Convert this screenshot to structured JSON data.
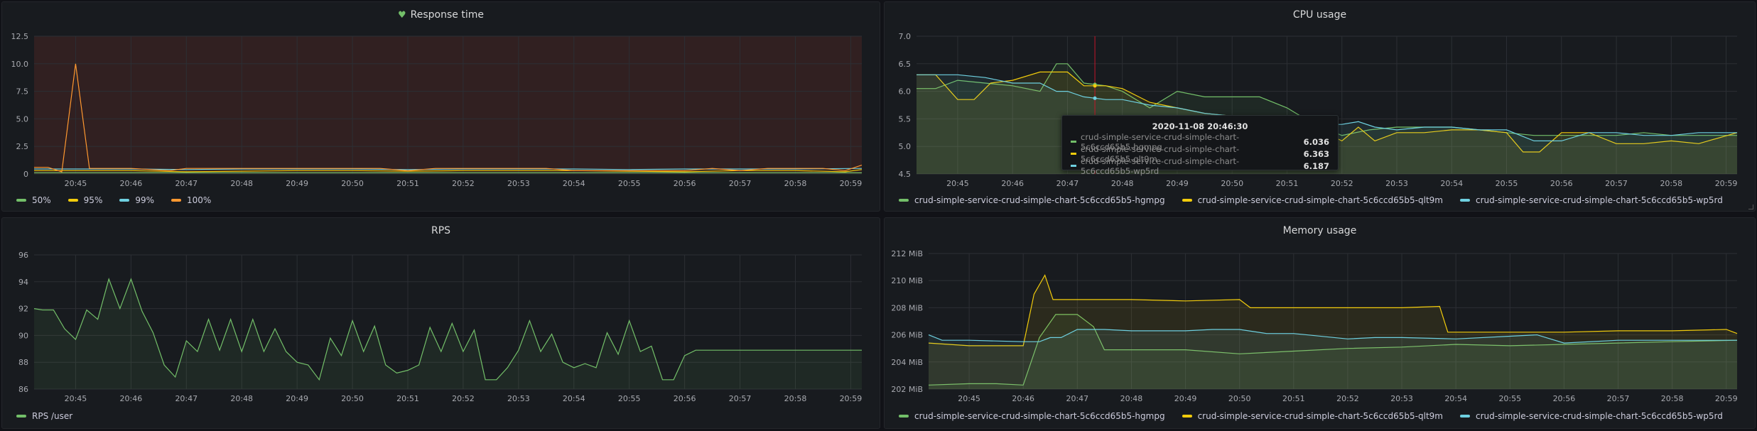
{
  "colors": {
    "green": "#73bf69",
    "yellow": "#f2cc0c",
    "blue": "#5794f2",
    "cyan": "#6ed0e0",
    "orange": "#ff9830",
    "olive": "#a8b25a"
  },
  "panels": {
    "response_time": {
      "title": "Response time",
      "legend": [
        {
          "label": "50%",
          "color": "#73bf69"
        },
        {
          "label": "95%",
          "color": "#f2cc0c"
        },
        {
          "label": "99%",
          "color": "#6ed0e0"
        },
        {
          "label": "100%",
          "color": "#ff9830"
        }
      ]
    },
    "cpu_usage": {
      "title": "CPU usage",
      "legend": [
        {
          "label": "crud-simple-service-crud-simple-chart-5c6ccd65b5-hgmpg",
          "color": "#73bf69"
        },
        {
          "label": "crud-simple-service-crud-simple-chart-5c6ccd65b5-qlt9m",
          "color": "#f2cc0c"
        },
        {
          "label": "crud-simple-service-crud-simple-chart-5c6ccd65b5-wp5rd",
          "color": "#6ed0e0"
        }
      ],
      "tooltip": {
        "time": "2020-11-08 20:46:30",
        "rows": [
          {
            "name": "crud-simple-service-crud-simple-chart-5c6ccd65b5-hgmpg",
            "value": "6.036",
            "color": "#73bf69"
          },
          {
            "name": "crud-simple-service-crud-simple-chart-5c6ccd65b5-qlt9m",
            "value": "6.363",
            "color": "#f2cc0c"
          },
          {
            "name": "crud-simple-service-crud-simple-chart-5c6ccd65b5-wp5rd",
            "value": "6.187",
            "color": "#6ed0e0"
          }
        ]
      }
    },
    "rps": {
      "title": "RPS",
      "legend": [
        {
          "label": "RPS /user",
          "color": "#73bf69"
        }
      ]
    },
    "memory_usage": {
      "title": "Memory usage",
      "legend": [
        {
          "label": "crud-simple-service-crud-simple-chart-5c6ccd65b5-hgmpg",
          "color": "#73bf69"
        },
        {
          "label": "crud-simple-service-crud-simple-chart-5c6ccd65b5-qlt9m",
          "color": "#f2cc0c"
        },
        {
          "label": "crud-simple-service-crud-simple-chart-5c6ccd65b5-wp5rd",
          "color": "#6ed0e0"
        }
      ]
    }
  },
  "chart_data": [
    {
      "id": "response_time",
      "type": "line",
      "title": "Response time",
      "x_ticks": [
        "20:45",
        "20:46",
        "20:47",
        "20:48",
        "20:49",
        "20:50",
        "20:51",
        "20:52",
        "20:53",
        "20:54",
        "20:55",
        "20:56",
        "20:57",
        "20:58",
        "20:59"
      ],
      "x_range_minutes": [
        44.25,
        59.2
      ],
      "y_ticks": [
        "0",
        "2.5",
        "5.0",
        "7.5",
        "10.0",
        "12.5"
      ],
      "ylim": [
        0,
        12.5
      ],
      "threshold_fill": "#3a2323",
      "series": [
        {
          "name": "50%",
          "color": "#73bf69",
          "x": [
            44.25,
            45.0,
            46.0,
            47.0,
            48.0,
            49.0,
            50.0,
            51.0,
            52.0,
            53.0,
            54.0,
            55.0,
            56.0,
            57.0,
            58.0,
            59.2
          ],
          "y": [
            0.1,
            0.1,
            0.1,
            0.1,
            0.1,
            0.1,
            0.1,
            0.1,
            0.1,
            0.1,
            0.1,
            0.1,
            0.1,
            0.1,
            0.1,
            0.1
          ]
        },
        {
          "name": "95%",
          "color": "#f2cc0c",
          "x": [
            44.25,
            44.5,
            45.0,
            45.5,
            46.0,
            47.0,
            48.0,
            49.0,
            50.0,
            51.0,
            52.0,
            53.0,
            54.0,
            55.0,
            56.0,
            57.0,
            58.0,
            58.9,
            59.2
          ],
          "y": [
            0.3,
            0.3,
            0.3,
            0.3,
            0.3,
            0.2,
            0.25,
            0.3,
            0.3,
            0.25,
            0.3,
            0.3,
            0.3,
            0.25,
            0.2,
            0.3,
            0.3,
            0.2,
            0.4
          ]
        },
        {
          "name": "99%",
          "color": "#6ed0e0",
          "x": [
            44.25,
            45.0,
            46.0,
            47.0,
            48.0,
            49.0,
            50.0,
            51.0,
            52.0,
            53.0,
            54.0,
            55.0,
            56.0,
            57.0,
            58.0,
            59.2
          ],
          "y": [
            0.45,
            0.45,
            0.45,
            0.4,
            0.45,
            0.45,
            0.45,
            0.4,
            0.45,
            0.45,
            0.45,
            0.4,
            0.45,
            0.45,
            0.45,
            0.5
          ]
        },
        {
          "name": "100%",
          "color": "#ff9830",
          "x": [
            44.25,
            44.5,
            44.75,
            45.0,
            45.25,
            45.5,
            46.0,
            46.7,
            47.0,
            47.5,
            48.0,
            48.5,
            49.0,
            49.5,
            50.0,
            50.5,
            51.0,
            51.5,
            52.0,
            52.5,
            53.0,
            53.5,
            54.0,
            54.5,
            55.0,
            55.5,
            56.0,
            56.5,
            57.0,
            57.5,
            58.0,
            58.5,
            58.9,
            59.2
          ],
          "y": [
            0.6,
            0.6,
            0.2,
            10.0,
            0.5,
            0.5,
            0.5,
            0.3,
            0.5,
            0.5,
            0.5,
            0.5,
            0.5,
            0.5,
            0.5,
            0.5,
            0.3,
            0.5,
            0.5,
            0.5,
            0.5,
            0.5,
            0.3,
            0.3,
            0.3,
            0.3,
            0.3,
            0.5,
            0.3,
            0.5,
            0.5,
            0.5,
            0.3,
            0.8
          ]
        }
      ]
    },
    {
      "id": "cpu_usage",
      "type": "area",
      "title": "CPU usage",
      "x_ticks": [
        "20:45",
        "20:46",
        "20:47",
        "20:48",
        "20:49",
        "20:50",
        "20:51",
        "20:52",
        "20:53",
        "20:54",
        "20:55",
        "20:56",
        "20:57",
        "20:58",
        "20:59"
      ],
      "x_range_minutes": [
        44.25,
        59.2
      ],
      "y_ticks": [
        "4.5",
        "5.0",
        "5.5",
        "6.0",
        "6.5",
        "7.0"
      ],
      "ylim": [
        4.5,
        7.0
      ],
      "crosshair_minute": 47.5,
      "series": [
        {
          "name": "crud-simple-service-crud-simple-chart-5c6ccd65b5-hgmpg",
          "color": "#73bf69",
          "x": [
            44.25,
            44.6,
            45.0,
            45.5,
            46.0,
            46.5,
            46.8,
            47.0,
            47.3,
            47.7,
            48.0,
            48.5,
            49.0,
            49.5,
            50.0,
            50.5,
            51.0,
            51.5,
            52.0,
            52.5,
            53.0,
            53.5,
            54.0,
            54.5,
            55.0,
            55.5,
            56.0,
            56.5,
            57.0,
            57.5,
            58.0,
            58.5,
            59.2
          ],
          "y": [
            6.05,
            6.05,
            6.2,
            6.15,
            6.1,
            6.0,
            6.5,
            6.5,
            6.15,
            6.1,
            6.0,
            5.7,
            6.0,
            5.9,
            5.9,
            5.9,
            5.7,
            5.4,
            5.2,
            5.3,
            5.35,
            5.35,
            5.35,
            5.3,
            5.25,
            5.2,
            5.2,
            5.2,
            5.2,
            5.25,
            5.2,
            5.2,
            5.2
          ]
        },
        {
          "name": "crud-simple-service-crud-simple-chart-5c6ccd65b5-qlt9m",
          "color": "#f2cc0c",
          "x": [
            44.25,
            44.6,
            45.0,
            45.3,
            45.6,
            46.0,
            46.5,
            47.0,
            47.3,
            47.7,
            48.0,
            48.5,
            49.0,
            49.5,
            50.0,
            50.5,
            51.0,
            51.5,
            52.0,
            52.3,
            52.6,
            53.0,
            53.5,
            54.0,
            54.5,
            55.0,
            55.3,
            55.6,
            56.0,
            56.5,
            57.0,
            57.5,
            58.0,
            58.5,
            59.2
          ],
          "y": [
            6.3,
            6.3,
            5.85,
            5.85,
            6.15,
            6.2,
            6.35,
            6.35,
            6.1,
            6.1,
            6.05,
            5.8,
            5.7,
            5.6,
            5.55,
            5.55,
            5.4,
            5.35,
            5.1,
            5.35,
            5.1,
            5.25,
            5.25,
            5.3,
            5.3,
            5.25,
            4.9,
            4.9,
            5.25,
            5.25,
            5.05,
            5.05,
            5.1,
            5.05,
            5.25
          ]
        },
        {
          "name": "crud-simple-service-crud-simple-chart-5c6ccd65b5-wp5rd",
          "color": "#6ed0e0",
          "x": [
            44.25,
            44.6,
            45.0,
            45.5,
            46.0,
            46.5,
            46.8,
            47.0,
            47.3,
            47.7,
            48.0,
            48.5,
            49.0,
            49.5,
            50.0,
            50.5,
            51.0,
            51.5,
            52.0,
            52.3,
            52.6,
            53.0,
            53.5,
            54.0,
            54.5,
            55.0,
            55.5,
            56.0,
            56.5,
            57.0,
            57.5,
            58.0,
            58.5,
            59.2
          ],
          "y": [
            6.3,
            6.3,
            6.3,
            6.25,
            6.15,
            6.15,
            6.0,
            6.0,
            5.9,
            5.85,
            5.85,
            5.75,
            5.7,
            5.6,
            5.55,
            5.55,
            5.45,
            5.4,
            5.4,
            5.45,
            5.35,
            5.3,
            5.35,
            5.35,
            5.3,
            5.3,
            5.1,
            5.1,
            5.25,
            5.25,
            5.2,
            5.2,
            5.25,
            5.25
          ]
        }
      ]
    },
    {
      "id": "rps",
      "type": "area",
      "title": "RPS",
      "x_ticks": [
        "20:45",
        "20:46",
        "20:47",
        "20:48",
        "20:49",
        "20:50",
        "20:51",
        "20:52",
        "20:53",
        "20:54",
        "20:55",
        "20:56",
        "20:57",
        "20:58",
        "20:59"
      ],
      "x_range_minutes": [
        44.25,
        59.2
      ],
      "y_ticks": [
        "86",
        "88",
        "90",
        "92",
        "94",
        "96"
      ],
      "ylim": [
        86,
        96
      ],
      "series": [
        {
          "name": "RPS /user",
          "color": "#73bf69",
          "x": [
            44.25,
            44.4,
            44.6,
            44.8,
            45.0,
            45.2,
            45.4,
            45.6,
            45.8,
            46.0,
            46.2,
            46.4,
            46.6,
            46.8,
            47.0,
            47.2,
            47.4,
            47.6,
            47.8,
            48.0,
            48.2,
            48.4,
            48.6,
            48.8,
            49.0,
            49.2,
            49.4,
            49.6,
            49.8,
            50.0,
            50.2,
            50.4,
            50.6,
            50.8,
            51.0,
            51.2,
            51.4,
            51.6,
            51.8,
            52.0,
            52.2,
            52.4,
            52.6,
            52.8,
            53.0,
            53.2,
            53.4,
            53.6,
            53.8,
            54.0,
            54.2,
            54.4,
            54.6,
            54.8,
            55.0,
            55.2,
            55.4,
            55.6,
            55.8,
            56.0,
            56.2,
            56.4,
            56.6,
            56.8,
            57.0,
            57.2,
            57.4,
            57.6,
            57.8,
            58.0,
            58.2,
            58.4,
            58.6,
            58.8,
            59.0,
            59.2
          ],
          "y": [
            92.0,
            91.9,
            91.9,
            90.5,
            89.7,
            91.9,
            91.2,
            94.2,
            92.0,
            94.2,
            91.8,
            90.2,
            87.8,
            86.9,
            89.6,
            88.8,
            91.2,
            88.9,
            91.2,
            88.8,
            91.2,
            88.8,
            90.5,
            88.8,
            88.0,
            87.8,
            86.7,
            89.8,
            88.5,
            91.1,
            88.8,
            90.7,
            87.8,
            87.2,
            87.4,
            87.8,
            90.6,
            88.8,
            90.9,
            88.8,
            90.4,
            86.7,
            86.7,
            87.6,
            88.9,
            91.1,
            88.8,
            90.1,
            88.0,
            87.6,
            87.9,
            87.6,
            90.2,
            88.6,
            91.1,
            88.8,
            89.2,
            86.7,
            86.7,
            88.5,
            88.9,
            88.9,
            88.9,
            88.9,
            88.9,
            88.9,
            88.9,
            88.9,
            88.9,
            88.9,
            88.9,
            88.9,
            88.9,
            88.9,
            88.9,
            88.9
          ]
        }
      ]
    },
    {
      "id": "memory_usage",
      "type": "area",
      "title": "Memory usage",
      "x_ticks": [
        "20:45",
        "20:46",
        "20:47",
        "20:48",
        "20:49",
        "20:50",
        "20:51",
        "20:52",
        "20:53",
        "20:54",
        "20:55",
        "20:56",
        "20:57",
        "20:58",
        "20:59"
      ],
      "x_range_minutes": [
        44.25,
        59.2
      ],
      "y_ticks": [
        "202 MiB",
        "204 MiB",
        "206 MiB",
        "208 MiB",
        "210 MiB",
        "212 MiB"
      ],
      "ylim": [
        202,
        212
      ],
      "series": [
        {
          "name": "crud-simple-service-crud-simple-chart-5c6ccd65b5-hgmpg",
          "color": "#73bf69",
          "x": [
            44.25,
            45.0,
            45.5,
            46.0,
            46.3,
            46.6,
            47.0,
            47.3,
            47.5,
            48.0,
            49.0,
            50.0,
            51.0,
            52.0,
            53.0,
            54.0,
            55.0,
            56.0,
            57.0,
            58.0,
            59.2
          ],
          "y": [
            202.3,
            202.4,
            202.4,
            202.3,
            205.8,
            207.5,
            207.5,
            206.6,
            204.9,
            204.9,
            204.9,
            204.6,
            204.8,
            205.0,
            205.1,
            205.3,
            205.2,
            205.3,
            205.4,
            205.5,
            205.6
          ]
        },
        {
          "name": "crud-simple-service-crud-simple-chart-5c6ccd65b5-qlt9m",
          "color": "#f2cc0c",
          "x": [
            44.25,
            45.0,
            45.5,
            46.0,
            46.2,
            46.4,
            46.55,
            47.0,
            48.0,
            49.0,
            50.0,
            50.2,
            51.0,
            52.0,
            53.0,
            53.7,
            53.85,
            54.5,
            55.0,
            56.0,
            57.0,
            58.0,
            59.0,
            59.2
          ],
          "y": [
            205.4,
            205.2,
            205.2,
            205.2,
            209.0,
            210.4,
            208.6,
            208.6,
            208.6,
            208.5,
            208.6,
            208.0,
            208.0,
            208.0,
            208.0,
            208.1,
            206.2,
            206.2,
            206.2,
            206.2,
            206.3,
            206.3,
            206.4,
            206.1
          ]
        },
        {
          "name": "crud-simple-service-crud-simple-chart-5c6ccd65b5-wp5rd",
          "color": "#6ed0e0",
          "x": [
            44.25,
            44.5,
            45.0,
            46.0,
            46.3,
            46.5,
            46.7,
            47.0,
            47.5,
            48.0,
            49.0,
            49.5,
            50.0,
            50.5,
            51.0,
            52.0,
            52.5,
            53.0,
            54.0,
            55.0,
            55.5,
            56.0,
            57.0,
            58.0,
            59.2
          ],
          "y": [
            206.0,
            205.6,
            205.6,
            205.5,
            205.5,
            205.8,
            205.8,
            206.4,
            206.4,
            206.3,
            206.3,
            206.4,
            206.4,
            206.1,
            206.1,
            205.7,
            205.8,
            205.8,
            205.7,
            205.9,
            206.0,
            205.4,
            205.6,
            205.6,
            205.6
          ]
        }
      ]
    }
  ]
}
